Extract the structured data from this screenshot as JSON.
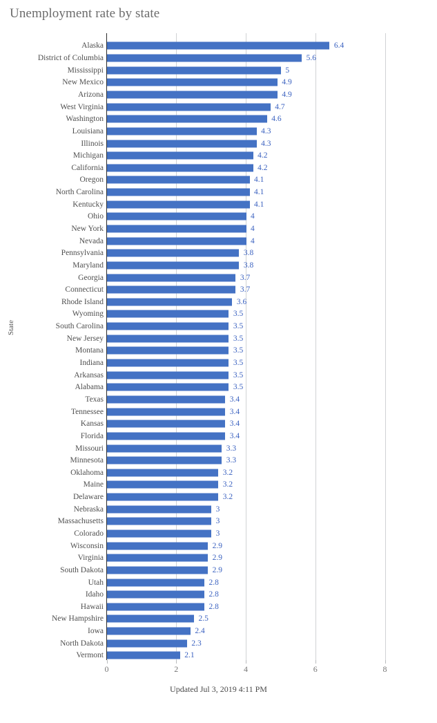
{
  "chart_data": {
    "type": "bar",
    "orientation": "horizontal",
    "title": "Unemployment rate by state",
    "xlabel": "",
    "ylabel": "State",
    "xlim": [
      0,
      8
    ],
    "xticks": [
      "0",
      "2",
      "4",
      "6",
      "8"
    ],
    "grid": true,
    "legend": null,
    "bar_color": "#4472c4",
    "value_label_color": "#3b62c0",
    "categories": [
      "Alaska",
      "District of Columbia",
      "Mississippi",
      "New Mexico",
      "Arizona",
      "West Virginia",
      "Washington",
      "Louisiana",
      "Illinois",
      "Michigan",
      "California",
      "Oregon",
      "North Carolina",
      "Kentucky",
      "Ohio",
      "New York",
      "Nevada",
      "Pennsylvania",
      "Maryland",
      "Georgia",
      "Connecticut",
      "Rhode Island",
      "Wyoming",
      "South Carolina",
      "New Jersey",
      "Montana",
      "Indiana",
      "Arkansas",
      "Alabama",
      "Texas",
      "Tennessee",
      "Kansas",
      "Florida",
      "Missouri",
      "Minnesota",
      "Oklahoma",
      "Maine",
      "Delaware",
      "Nebraska",
      "Massachusetts",
      "Colorado",
      "Wisconsin",
      "Virginia",
      "South Dakota",
      "Utah",
      "Idaho",
      "Hawaii",
      "New Hampshire",
      "Iowa",
      "North Dakota",
      "Vermont"
    ],
    "values": [
      6.4,
      5.6,
      5,
      4.9,
      4.9,
      4.7,
      4.6,
      4.3,
      4.3,
      4.2,
      4.2,
      4.1,
      4.1,
      4.1,
      4,
      4,
      4,
      3.8,
      3.8,
      3.7,
      3.7,
      3.6,
      3.5,
      3.5,
      3.5,
      3.5,
      3.5,
      3.5,
      3.5,
      3.4,
      3.4,
      3.4,
      3.4,
      3.3,
      3.3,
      3.2,
      3.2,
      3.2,
      3,
      3,
      3,
      2.9,
      2.9,
      2.9,
      2.8,
      2.8,
      2.8,
      2.5,
      2.4,
      2.3,
      2.1
    ],
    "value_labels": [
      "6.4",
      "5.6",
      "5",
      "4.9",
      "4.9",
      "4.7",
      "4.6",
      "4.3",
      "4.3",
      "4.2",
      "4.2",
      "4.1",
      "4.1",
      "4.1",
      "4",
      "4",
      "4",
      "3.8",
      "3.8",
      "3.7",
      "3.7",
      "3.6",
      "3.5",
      "3.5",
      "3.5",
      "3.5",
      "3.5",
      "3.5",
      "3.5",
      "3.4",
      "3.4",
      "3.4",
      "3.4",
      "3.3",
      "3.3",
      "3.2",
      "3.2",
      "3.2",
      "3",
      "3",
      "3",
      "2.9",
      "2.9",
      "2.9",
      "2.8",
      "2.8",
      "2.8",
      "2.5",
      "2.4",
      "2.3",
      "2.1"
    ]
  },
  "footer": {
    "updated_text": "Updated Jul 3, 2019 4:11 PM"
  }
}
